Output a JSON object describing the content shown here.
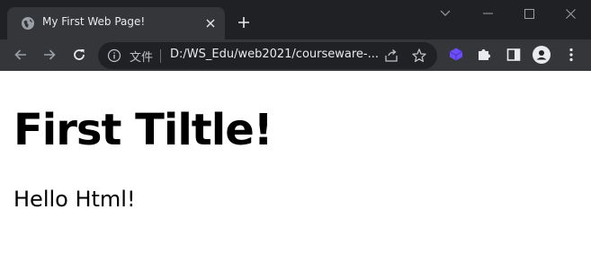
{
  "tab": {
    "title": "My First Web Page!",
    "favicon_icon": "globe-icon",
    "close_icon": "close-icon"
  },
  "window_controls": [
    "chevron-down-icon",
    "minimize-icon",
    "maximize-icon",
    "close-window-icon"
  ],
  "toolbar": {
    "back_icon": "arrow-back-icon",
    "forward_icon": "arrow-forward-icon",
    "reload_icon": "reload-icon"
  },
  "omnibox": {
    "site_chip": "文件",
    "url": "D:/WS_Edu/web2021/courseware-...",
    "share_icon": "share-icon",
    "bookmark_icon": "star-icon"
  },
  "extensions": [
    "extension-cube-icon",
    "puzzle-icon",
    "sidepanel-icon",
    "profile-icon",
    "more-vert-icon"
  ],
  "page": {
    "heading": "First Tiltle!",
    "paragraph": "Hello Html!"
  },
  "colors": {
    "tabstrip": "#202124",
    "toolbar": "#35363a",
    "omnibox": "#202124",
    "page_bg": "#ffffff",
    "extension_accent": "#6c4df6"
  }
}
